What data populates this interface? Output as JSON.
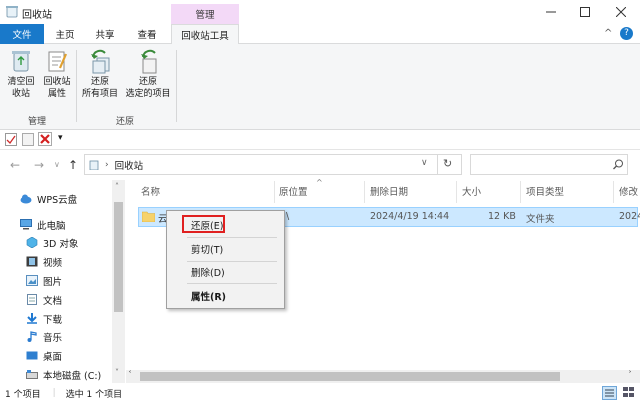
{
  "window": {
    "title": "回收站",
    "controls": [
      "minimize",
      "maximize",
      "close"
    ]
  },
  "ribbon": {
    "context_group": "管理",
    "tabs": [
      {
        "label": "文件"
      },
      {
        "label": "主页"
      },
      {
        "label": "共享"
      },
      {
        "label": "查看"
      },
      {
        "label": "回收站工具"
      }
    ],
    "groups": [
      {
        "label": "管理",
        "buttons": [
          {
            "label": "清空回\n收站",
            "icon": "recycle-bin-icon"
          },
          {
            "label": "回收站\n属性",
            "icon": "properties-icon"
          }
        ]
      },
      {
        "label": "还原",
        "buttons": [
          {
            "label": "还原\n所有项目",
            "icon": "restore-all-icon"
          },
          {
            "label": "还原\n选定的项目",
            "icon": "restore-selected-icon"
          }
        ]
      }
    ]
  },
  "address": {
    "path": "回收站",
    "search_placeholder": ""
  },
  "nav": {
    "items": [
      {
        "label": "WPS云盘",
        "icon": "cloud-icon"
      },
      {
        "label": "此电脑",
        "icon": "computer-icon"
      },
      {
        "label": "3D 对象",
        "icon": "3d-objects-icon"
      },
      {
        "label": "视频",
        "icon": "video-icon"
      },
      {
        "label": "图片",
        "icon": "pictures-icon"
      },
      {
        "label": "文档",
        "icon": "documents-icon"
      },
      {
        "label": "下载",
        "icon": "download-icon"
      },
      {
        "label": "音乐",
        "icon": "music-icon"
      },
      {
        "label": "桌面",
        "icon": "desktop-icon"
      },
      {
        "label": "本地磁盘 (C:)",
        "icon": "drive-icon"
      }
    ]
  },
  "columns": [
    "名称",
    "原位置",
    "删除日期",
    "大小",
    "项目类型",
    "修改"
  ],
  "files": [
    {
      "name": "云",
      "location": "\\",
      "deleted": "2024/4/19 14:44",
      "size": "12 KB",
      "type": "文件夹",
      "modified": "2024"
    }
  ],
  "context_menu": {
    "items": [
      "还原(E)",
      "剪切(T)",
      "删除(D)",
      "属性(R)"
    ]
  },
  "status": {
    "count": "1 个项目",
    "selected": "选中 1 个项目"
  },
  "colors": {
    "file_tab": "#1979ca",
    "context_tab": "#f3d9f7",
    "selection": "#cce8ff",
    "highlight_box": "#e02020"
  }
}
